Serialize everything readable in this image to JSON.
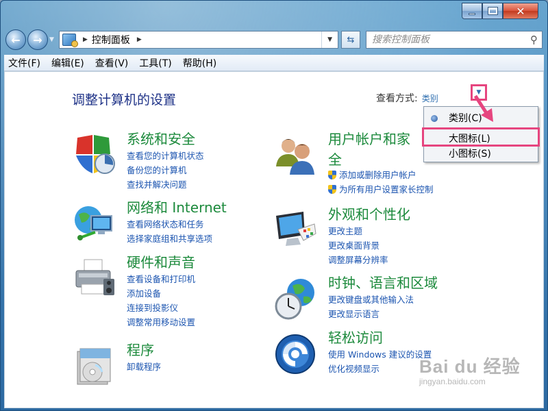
{
  "window": {
    "caption_buttons": {
      "minimize": "minimize-icon",
      "maximize": "maximize-icon",
      "close": "close-icon"
    }
  },
  "address": {
    "path": "控制面板",
    "search_placeholder": "搜索控制面板"
  },
  "menu": [
    "文件(F)",
    "编辑(E)",
    "查看(V)",
    "工具(T)",
    "帮助(H)"
  ],
  "main": {
    "title": "调整计算机的设置",
    "view_by_label": "查看方式:",
    "view_by_value": "类别"
  },
  "categories": [
    {
      "title": "系统和安全",
      "icon": "shield-icon",
      "links": [
        "查看您的计算机状态",
        "备份您的计算机",
        "查找并解决问题"
      ]
    },
    {
      "title": "网络和 Internet",
      "icon": "network-globe-icon",
      "links": [
        "查看网络状态和任务",
        "选择家庭组和共享选项"
      ]
    },
    {
      "title": "硬件和声音",
      "icon": "printer-icon",
      "links": [
        "查看设备和打印机",
        "添加设备",
        "连接到投影仪",
        "调整常用移动设置"
      ]
    },
    {
      "title": "程序",
      "icon": "programs-disc-icon",
      "links": [
        "卸载程序"
      ]
    },
    {
      "title_line1": "用户帐户和家",
      "title_line2": "全",
      "icon": "users-icon",
      "links": [
        "添加或删除用户帐户",
        "为所有用户设置家长控制"
      ]
    },
    {
      "title": "外观和个性化",
      "icon": "monitor-palette-icon",
      "links": [
        "更改主题",
        "更改桌面背景",
        "调整屏幕分辨率"
      ]
    },
    {
      "title": "时钟、语言和区域",
      "icon": "clock-globe-icon",
      "links": [
        "更改键盘或其他输入法",
        "更改显示语言"
      ]
    },
    {
      "title": "轻松访问",
      "icon": "ease-of-access-icon",
      "links": [
        "使用 Windows 建议的设置",
        "优化视频显示"
      ]
    }
  ],
  "dropdown": {
    "items": [
      "类别(C)",
      "大图标(L)",
      "小图标(S)"
    ],
    "selected": "类别(C)",
    "highlighted": "大图标(L)"
  },
  "watermark": {
    "big": "Bai du 经验",
    "small": "jingyan.baidu.com"
  },
  "colors": {
    "category_title": "#1c8a3c",
    "link": "#1c55b0",
    "annotation": "#e6457f"
  }
}
